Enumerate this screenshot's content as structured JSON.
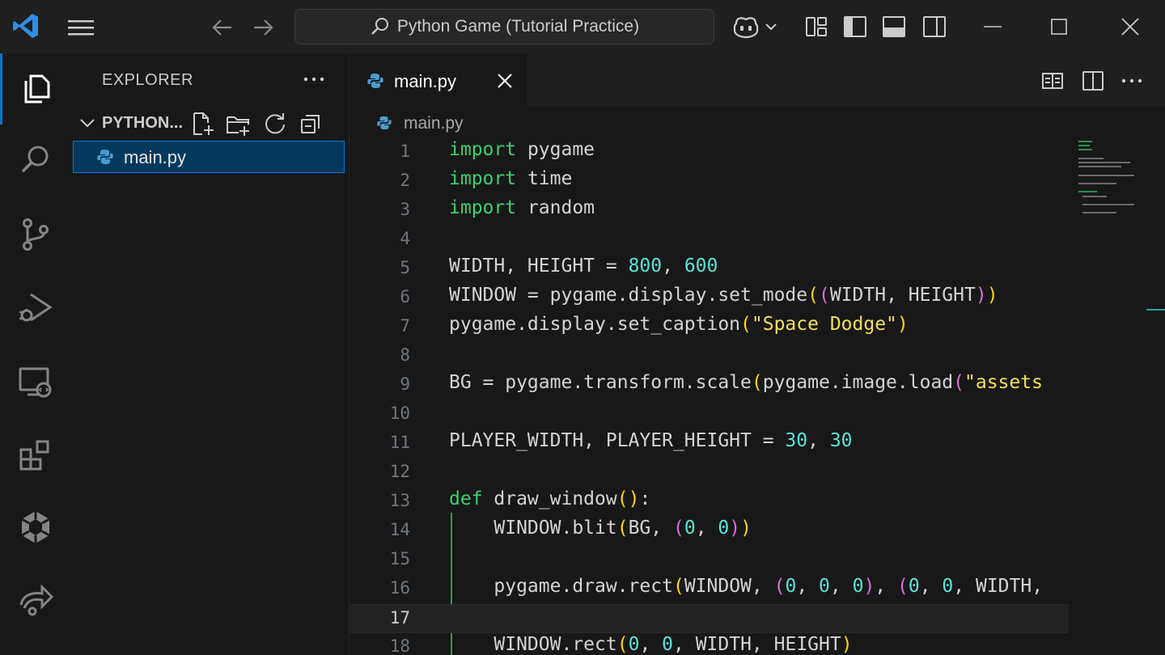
{
  "window": {
    "search_text": "Python Game (Tutorial Practice)"
  },
  "sidebar": {
    "header": "EXPLORER",
    "section_title": "PYTHON...",
    "files": [
      {
        "name": "main.py"
      }
    ]
  },
  "editor": {
    "tab_label": "main.py",
    "breadcrumb": "main.py",
    "current_line": 17,
    "lines": [
      {
        "number": "1",
        "text": "import pygame"
      },
      {
        "number": "2",
        "text": "import time"
      },
      {
        "number": "3",
        "text": "import random"
      },
      {
        "number": "4",
        "text": ""
      },
      {
        "number": "5",
        "text": "WIDTH, HEIGHT = 800, 600"
      },
      {
        "number": "6",
        "text": "WINDOW = pygame.display.set_mode((WIDTH, HEIGHT))"
      },
      {
        "number": "7",
        "text": "pygame.display.set_caption(\"Space Dodge\")"
      },
      {
        "number": "8",
        "text": ""
      },
      {
        "number": "9",
        "text": "BG = pygame.transform.scale(pygame.image.load(\"assets"
      },
      {
        "number": "10",
        "text": ""
      },
      {
        "number": "11",
        "text": "PLAYER_WIDTH, PLAYER_HEIGHT = 30, 30"
      },
      {
        "number": "12",
        "text": ""
      },
      {
        "number": "13",
        "text": "def draw_window():"
      },
      {
        "number": "14",
        "text": "    WINDOW.blit(BG, (0, 0))"
      },
      {
        "number": "15",
        "text": ""
      },
      {
        "number": "16",
        "text": "    pygame.draw.rect(WINDOW, (0, 0, 0), (0, 0, WIDTH,"
      },
      {
        "number": "17",
        "text": ""
      },
      {
        "number": "18",
        "text": "    WINDOW.rect(0, 0, WIDTH, HEIGHT)"
      }
    ]
  },
  "colors": {
    "accent": "#0078d4",
    "keyword": "#3bd16f",
    "number": "#5ae3d8",
    "string": "#f1e05a",
    "bracket_level1": "#ffd700",
    "bracket_level2": "#da70d6",
    "selection": "#04395e"
  },
  "icons": {
    "activity_bar": [
      "explorer-icon",
      "search-icon",
      "source-control-icon",
      "run-debug-icon",
      "remote-explorer-icon",
      "extensions-icon",
      "extension-view-icon",
      "live-share-icon"
    ]
  }
}
